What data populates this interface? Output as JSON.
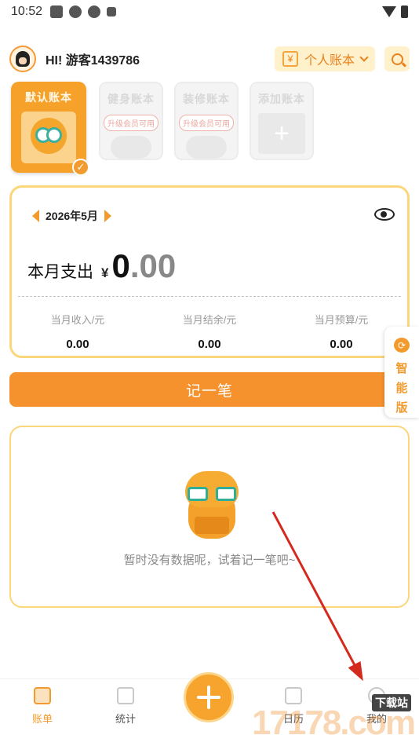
{
  "status_bar": {
    "time": "10:52"
  },
  "header": {
    "greeting": "HI! 游客1439786",
    "ledger_icon_char": "¥",
    "ledger_switch_label": "个人账本"
  },
  "books": [
    {
      "title": "默认账本",
      "active": true
    },
    {
      "title": "健身账本",
      "tag": "升级会员可用"
    },
    {
      "title": "装修账本",
      "tag": "升级会员可用"
    },
    {
      "title": "添加账本",
      "plus": "+"
    }
  ],
  "summary": {
    "month": "2026年5月",
    "expense_label": "本月支出",
    "currency": "¥",
    "amount_int": "0",
    "amount_dec": ".00",
    "stats": [
      {
        "label": "当月收入/元",
        "value": "0.00"
      },
      {
        "label": "当月结余/元",
        "value": "0.00"
      },
      {
        "label": "当月预算/元",
        "value": "0.00"
      }
    ]
  },
  "record_button": "记一笔",
  "smart_tab": {
    "icon_char": "⟳",
    "label": "智能版"
  },
  "empty_state": {
    "message": "暂时没有数据呢，试着记一笔吧~"
  },
  "tabbar": {
    "tabs": [
      {
        "label": "账单",
        "active": true
      },
      {
        "label": "统计"
      },
      {
        "label": "日历"
      },
      {
        "label": "我的"
      }
    ]
  },
  "watermark": {
    "text": "17178.com",
    "tag": "下载站"
  },
  "colors": {
    "accent": "#f6922e",
    "card_border": "#fcd67a",
    "annotation_arrow": "#d42a1e"
  }
}
